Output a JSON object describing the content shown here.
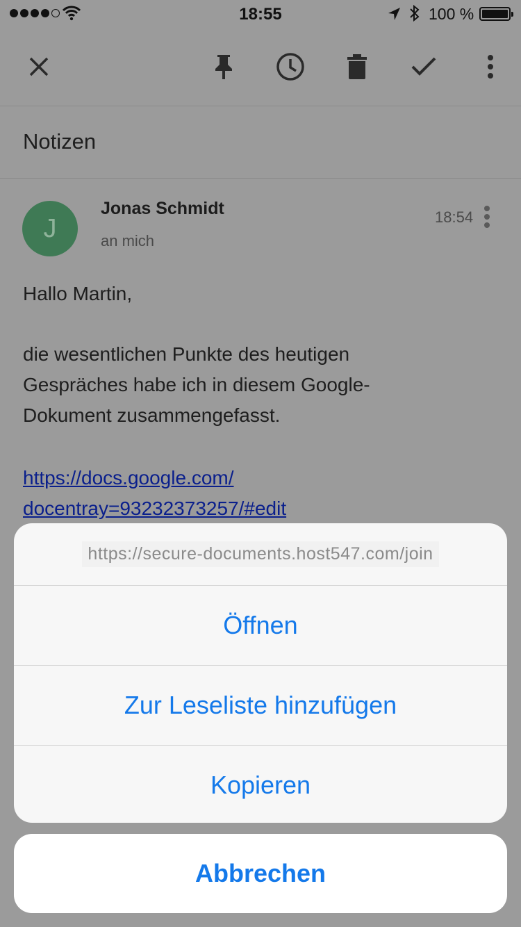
{
  "status_bar": {
    "time": "18:55",
    "battery_text": "100 %",
    "signal_bars_filled": 4,
    "signal_bars_total": 5
  },
  "toolbar": {
    "icons": [
      "close-icon",
      "pin-icon",
      "snooze-clock-icon",
      "trash-icon",
      "checkmark-icon",
      "more-vert-icon"
    ]
  },
  "label": "Notizen",
  "message": {
    "avatar_letter": "J",
    "avatar_color": "#3f7a55",
    "sender": "Jonas Schmidt",
    "recipient": "an mich",
    "time": "18:54",
    "greeting": "Hallo Martin,",
    "paragraph_lines": [
      "die wesentlichen Punkte des heutigen",
      "Gespräches habe ich in diesem Google-",
      "Dokument zusammengefasst."
    ],
    "link_lines": [
      "https://docs.google.com/",
      "docentray=93232373257/#edit"
    ]
  },
  "action_sheet": {
    "url": "https://secure-documents.host547.com/join",
    "open": "Öffnen",
    "reading_list": "Zur Leseliste hinzufügen",
    "copy": "Kopieren",
    "cancel": "Abbrechen"
  },
  "colors": {
    "action_blue": "#1479ea",
    "link": "#0a1f8c",
    "dim_background": "#9b9b9b"
  }
}
